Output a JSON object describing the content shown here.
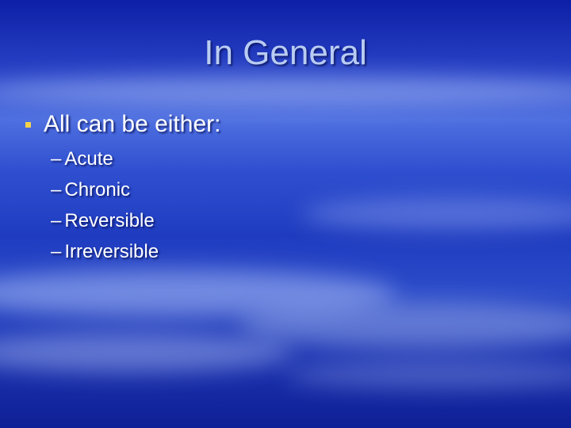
{
  "slide": {
    "title": "In General",
    "bullet": "All can be either:",
    "dash": "–",
    "subitems": [
      "Acute",
      "Chronic",
      "Reversible",
      "Irreversible"
    ]
  },
  "colors": {
    "title": "#b9ccf2",
    "text": "#ffffff",
    "bullet_marker": "#f2d24a",
    "background": "#2a45c8"
  }
}
